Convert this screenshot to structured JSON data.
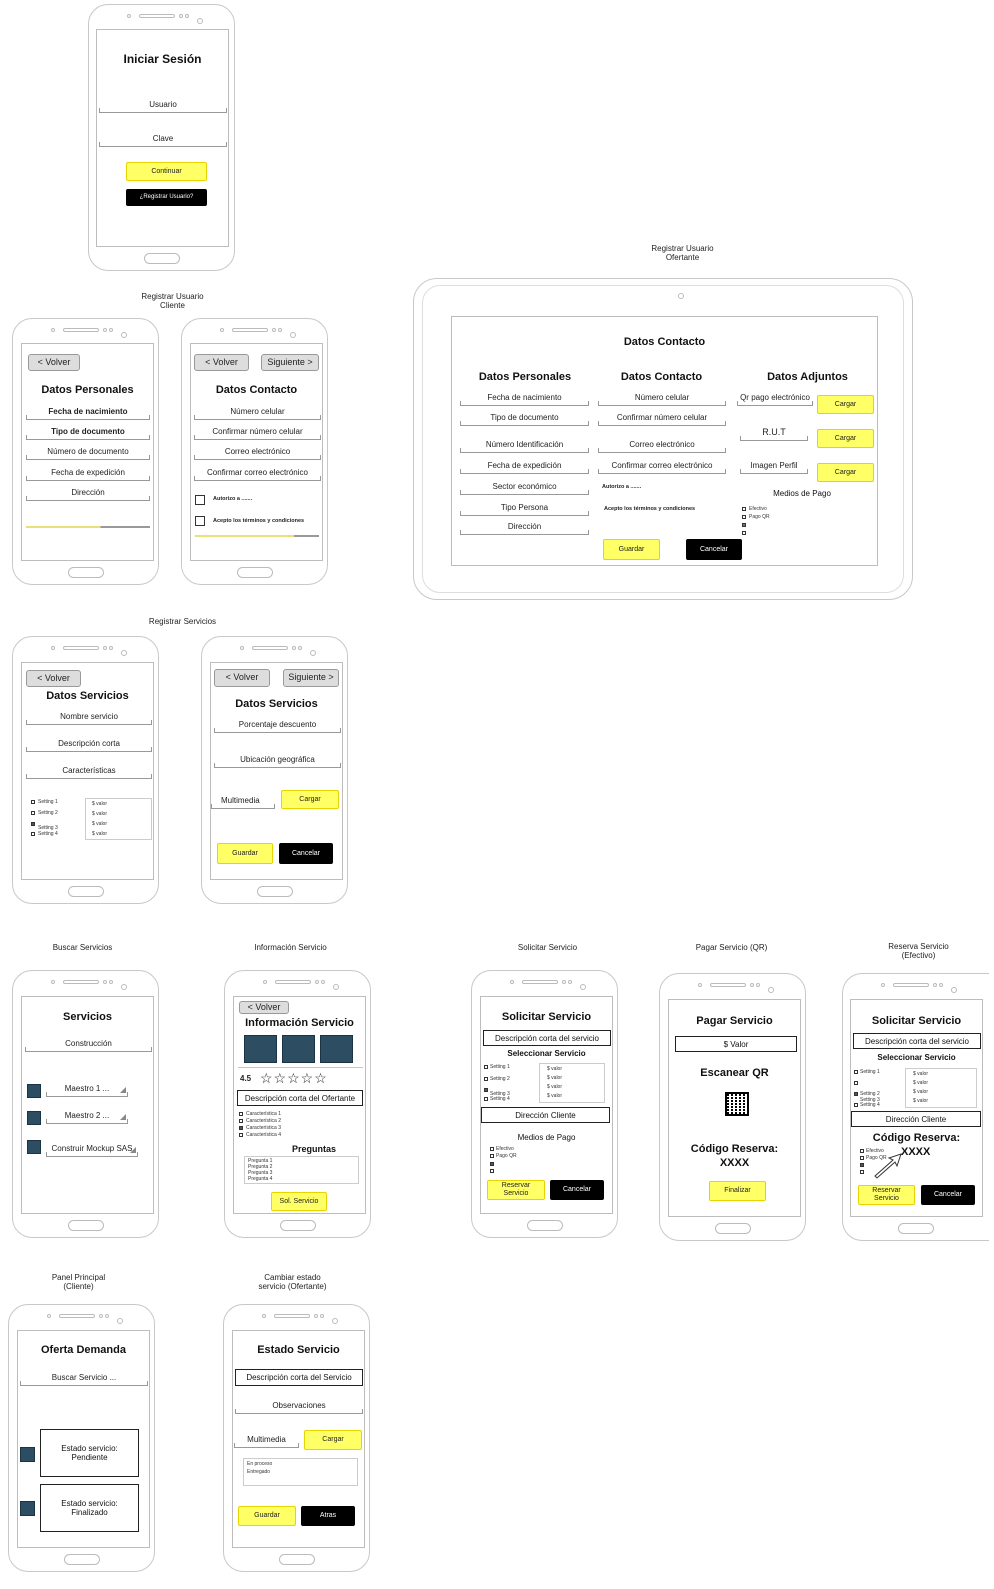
{
  "captions": {
    "reg_cliente": "Registrar Usuario\nCliente",
    "reg_ofertante": "Registrar Usuario\nOfertante",
    "reg_servicios": "Registrar Servicios",
    "buscar": "Buscar Servicios",
    "info": "Información Servicio",
    "solicitar": "Solicitar Servicio",
    "pagar_qr": "Pagar Servicio (QR)",
    "reserva_efectivo": "Reserva Servicio\n(Efectivo)",
    "panel": "Panel Principal\n(Cliente)",
    "cambiar_estado": "Cambiar estado\nservicio (Ofertante)"
  },
  "common": {
    "volver": "< Volver",
    "siguiente": "Siguiente >",
    "guardar": "Guardar",
    "cancelar": "Cancelar",
    "cargar": "Cargar"
  },
  "login": {
    "title": "Iniciar Sesión",
    "usuario": "Usuario",
    "clave": "Clave",
    "continuar": "Continuar",
    "registrar": "¿Registrar Usuario?"
  },
  "personales": {
    "title": "Datos Personales",
    "fields": [
      "Fecha de nacimiento",
      "Tipo de documento",
      "Número de documento",
      "Fecha de expedición",
      "Dirección"
    ]
  },
  "contacto": {
    "title": "Datos Contacto",
    "fields": [
      "Número celular",
      "Confirmar número celular",
      "Correo electrónico",
      "Confirmar correo electrónico"
    ],
    "autorizo": "Autorizo a .......",
    "acepto": "Acepto los términos y condiciones"
  },
  "tablet": {
    "title": "Datos Contacto",
    "col1_title": "Datos Personales",
    "col1": [
      "Fecha de nacimiento",
      "Tipo de documento",
      "Número Identificación",
      "Fecha de expedición",
      "Sector económico",
      "Tipo Persona",
      "Dirección"
    ],
    "col2_title": "Datos Contacto",
    "col2": [
      "Número celular",
      "Confirmar número celular",
      "Correo electrónico",
      "Confirmar correo electrónico"
    ],
    "autorizo": "Autorizo a .......",
    "acepto": "Acepto los términos y condiciones",
    "col3_title": "Datos Adjuntos",
    "col3": [
      "Qr pago electrónico",
      "R.U.T",
      "Imagen Perfil"
    ],
    "medios": "Medios de Pago",
    "medios_items": [
      "Efectivo",
      "Pago QR",
      "",
      ""
    ]
  },
  "serv1": {
    "title": "Datos Servicios",
    "fields": [
      "Nombre servicio",
      "Descripción corta",
      "Características"
    ],
    "settings": [
      "Setting 1",
      "Setting 2",
      "Setting 3",
      "Setting 4"
    ],
    "valor": "$ valor"
  },
  "serv2": {
    "title": "Datos Servicios",
    "fields": [
      "Porcentaje descuento",
      "Ubicación geográfica"
    ],
    "multimedia": "Multimedia"
  },
  "buscar": {
    "title": "Servicios",
    "search": "Construcción",
    "items": [
      "Maestro 1 ...",
      "Maestro 2 ...",
      "Construir Mockup SAS"
    ]
  },
  "info": {
    "title": "Información Servicio",
    "rating": "4.5",
    "stars": "☆☆☆☆☆",
    "desc": "Descripción corta del Ofertante",
    "features": [
      "Característica 1",
      "Característica 2",
      "Característica 3",
      "Característica 4"
    ],
    "preguntas": "Preguntas",
    "preguntas_items": [
      "Pregunta 1",
      "Pregunta 2",
      "Pregunta 3",
      "Pregunta 4"
    ],
    "btn": "Sol. Servicio"
  },
  "solicitar": {
    "title": "Solicitar Servicio",
    "desc": "Descripción corta del servicio",
    "sel": "Seleccionar Servicio",
    "settings": [
      "Setting 1",
      "Setting 2",
      "Setting 3",
      "Setting 4"
    ],
    "valor": "$ valor",
    "direccion": "Dirección Cliente",
    "medios": "Medios de Pago",
    "medios_items": [
      "Efectivo",
      "Pago QR",
      "",
      ""
    ],
    "reservar": "Reservar\nServicio"
  },
  "pagar": {
    "title": "Pagar Servicio",
    "valor": "$ Valor",
    "escanear": "Escanear QR",
    "codigo": "Código Reserva:\nXXXX",
    "finalizar": "Finalizar"
  },
  "reserva": {
    "title": "Solicitar Servicio",
    "desc": "Descripción corta del servicio",
    "sel": "Seleccionar Servicio",
    "settings": [
      "Setting 1",
      "",
      "Setting 2\nSetting 3",
      "Setting 4"
    ],
    "valor": "$ valor",
    "direccion": "Dirección Cliente",
    "codigo": "Código Reserva:",
    "xxxx": "XXXX",
    "medios_items": [
      "Efectivo",
      "Pago QR",
      "",
      ""
    ],
    "reservar": "Reservar\nServicio"
  },
  "panel": {
    "title": "Oferta Demanda",
    "search": "Buscar Servicio ...",
    "cards": [
      "Estado servicio:\nPendiente",
      "Estado servicio:\nFinalizado"
    ]
  },
  "estado": {
    "title": "Estado Servicio",
    "desc": "Descripción corta del Servicio",
    "obs": "Observaciones",
    "multimedia": "Multimedia",
    "list": [
      "En proceso",
      "Entregado"
    ],
    "atras": "Atras"
  }
}
